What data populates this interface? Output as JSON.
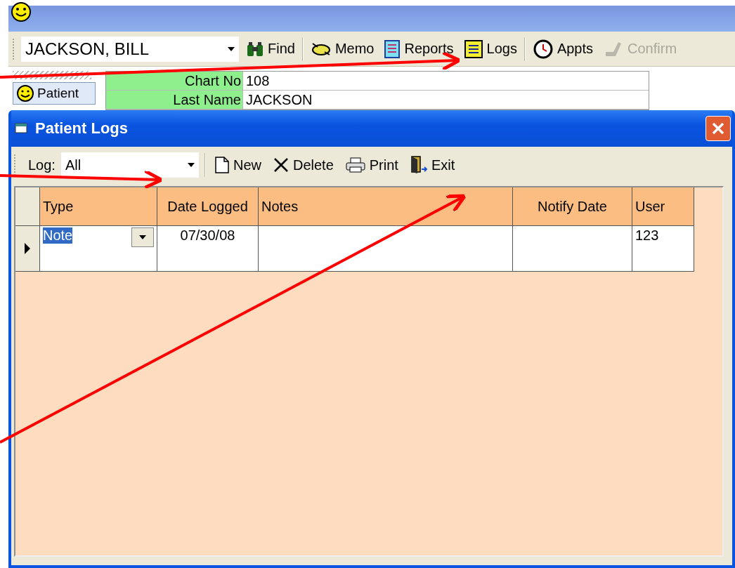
{
  "main": {
    "patient_selector": "JACKSON, BILL",
    "toolbar": [
      {
        "kind": "find",
        "label": "Find",
        "disabled": false
      },
      {
        "kind": "memo",
        "label": "Memo",
        "disabled": false
      },
      {
        "kind": "reports",
        "label": "Reports",
        "disabled": false
      },
      {
        "kind": "logs",
        "label": "Logs",
        "disabled": false
      },
      {
        "kind": "appts",
        "label": "Appts",
        "disabled": false
      },
      {
        "kind": "confirm",
        "label": "Confirm",
        "disabled": true
      }
    ],
    "side_tab": "Patient",
    "fields": [
      {
        "label": "Chart No",
        "value": "108"
      },
      {
        "label": "Last Name",
        "value": "JACKSON"
      }
    ]
  },
  "dialog": {
    "title": "Patient Logs",
    "log_filter": {
      "label": "Log:",
      "value": "All"
    },
    "toolbar": [
      {
        "kind": "new",
        "label": "New"
      },
      {
        "kind": "delete",
        "label": "Delete"
      },
      {
        "kind": "print",
        "label": "Print"
      },
      {
        "kind": "exit",
        "label": "Exit"
      }
    ],
    "table": {
      "columns": [
        {
          "label": "Type"
        },
        {
          "label": "Date Logged"
        },
        {
          "label": "Notes"
        },
        {
          "label": "Notify Date"
        },
        {
          "label": "User"
        }
      ],
      "rows": [
        {
          "current": true,
          "type": "Note",
          "type_selected": true,
          "date_logged": "07/30/08",
          "user": "123"
        }
      ]
    }
  }
}
